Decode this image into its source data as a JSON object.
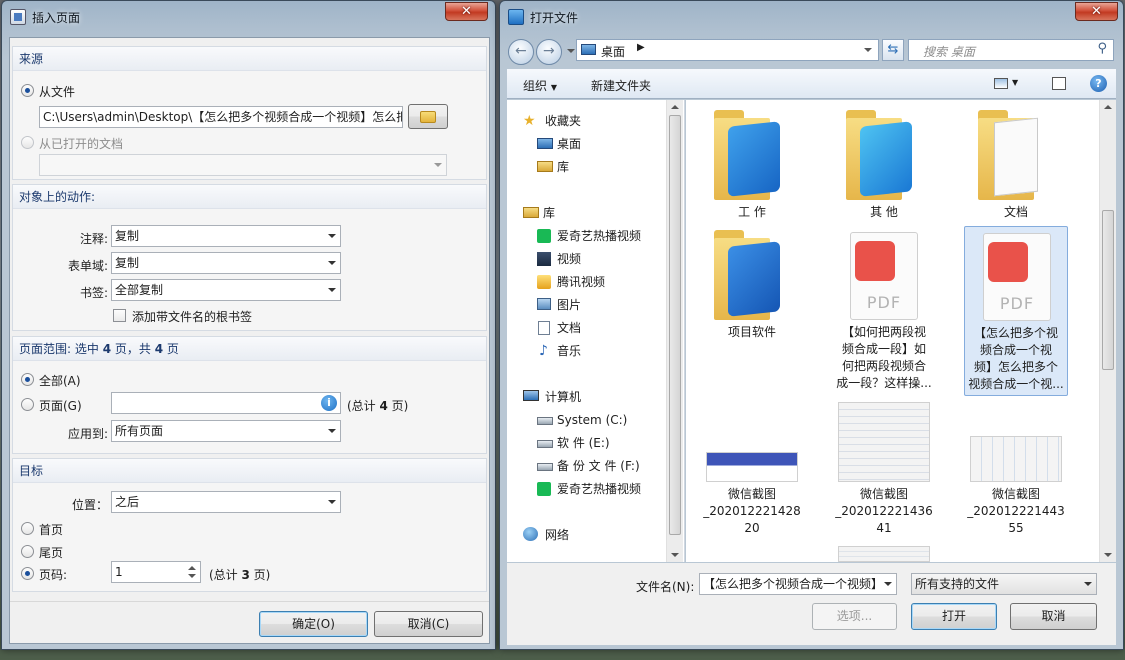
{
  "insert_dialog": {
    "title": "插入页面",
    "source": {
      "header": "来源",
      "from_file_label": "从文件",
      "from_file_path": "C:\\Users\\admin\\Desktop\\【怎么把多个视频合成一个视频】怎么把",
      "from_open_doc_label": "从已打开的文档"
    },
    "actions": {
      "header": "对象上的动作:",
      "comments_label": "注释:",
      "comments_value": "复制",
      "form_fields_label": "表单域:",
      "form_fields_value": "复制",
      "bookmarks_label": "书签:",
      "bookmarks_value": "全部复制",
      "add_root_bookmark_label": "添加带文件名的根书签"
    },
    "page_range": {
      "header_prefix": "页面范围: 选中 ",
      "selected_count": "4",
      "header_mid": " 页，共 ",
      "total_count": "4",
      "header_suffix": " 页",
      "all_label": "全部(A)",
      "pages_label": "页面(G)",
      "pages_value": "",
      "pages_total_prefix": "(总计 ",
      "pages_total_count": "4",
      "pages_total_suffix": " 页)",
      "apply_to_label": "应用到:",
      "apply_to_value": "所有页面"
    },
    "target": {
      "header": "目标",
      "position_label": "位置：",
      "position_value": "之后",
      "first_page_label": "首页",
      "last_page_label": "尾页",
      "page_number_label": "页码:",
      "page_number_value": "1",
      "page_total_prefix": "(总计 ",
      "page_total_count": "3",
      "page_total_suffix": " 页)"
    },
    "ok_label": "确定(O)",
    "cancel_label": "取消(C)"
  },
  "open_dialog": {
    "title": "打开文件",
    "address": {
      "location": "桌面",
      "search_placeholder": "搜索 桌面"
    },
    "toolbar": {
      "organize_label": "组织",
      "new_folder_label": "新建文件夹"
    },
    "nav": {
      "favorites_label": "收藏夹",
      "favorites": [
        "桌面",
        "库"
      ],
      "libraries_label": "库",
      "libraries": [
        "爱奇艺热播视频",
        "视频",
        "腾讯视频",
        "图片",
        "文档",
        "音乐"
      ],
      "computer_label": "计算机",
      "drives": [
        "System (C:)",
        "软 件 (E:)",
        "备 份 文 件 (F:)",
        "爱奇艺热播视频"
      ],
      "network_label": "网络"
    },
    "files": [
      {
        "name": "工 作",
        "type": "folder"
      },
      {
        "name": "其 他",
        "type": "folder"
      },
      {
        "name": "文档",
        "type": "folder"
      },
      {
        "name": "项目软件",
        "type": "folder"
      },
      {
        "name_lines": [
          "【如何把两段视",
          "频合成一段】如",
          "何把两段视频合",
          "成一段？这样操..."
        ],
        "badge": "PDF",
        "type": "pdf"
      },
      {
        "name_lines": [
          "【怎么把多个视",
          "频合成一个视",
          "频】怎么把多个",
          "视频合成一个视..."
        ],
        "badge": "PDF",
        "type": "pdf",
        "selected": true
      },
      {
        "name_lines": [
          "微信截图",
          "_202012221428",
          "20"
        ],
        "type": "image"
      },
      {
        "name_lines": [
          "微信截图",
          "_202012221436",
          "41"
        ],
        "type": "image"
      },
      {
        "name_lines": [
          "微信截图",
          "_202012221443",
          "55"
        ],
        "type": "image"
      }
    ],
    "footer": {
      "filename_label": "文件名(N):",
      "filename_value": "【怎么把多个视频合成一个视频】",
      "filetype_value": "所有支持的文件",
      "preview_label": "选项...",
      "open_label": "打开",
      "cancel_label": "取消"
    }
  },
  "colors": {
    "accent_blue": "#1c3a6e",
    "selection": "#dbe8f8",
    "pdf_red": "#e9524a",
    "folder_yellow": "#f4d36a"
  }
}
